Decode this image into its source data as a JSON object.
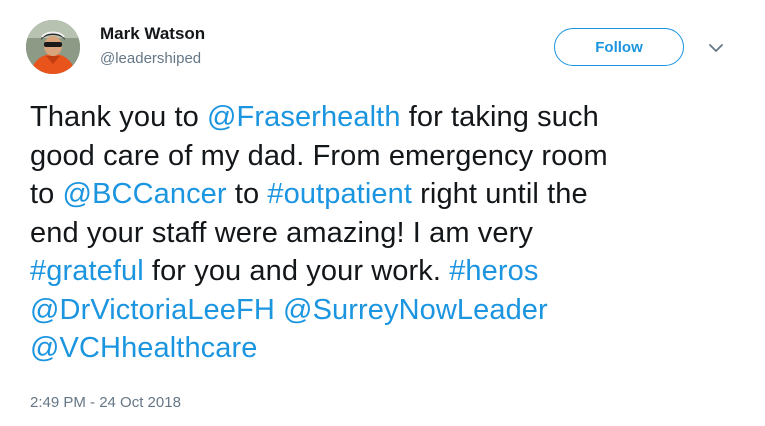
{
  "author": {
    "name": "Mark Watson",
    "handle": "@leadershiped"
  },
  "follow_label": "Follow",
  "tweet": {
    "lines": [
      [
        {
          "t": "Thank you to ",
          "link": false
        },
        {
          "t": "@Fraserhealth",
          "link": true
        },
        {
          "t": " for taking such",
          "link": false
        }
      ],
      [
        {
          "t": "good care of my dad. From emergency room",
          "link": false
        }
      ],
      [
        {
          "t": "to ",
          "link": false
        },
        {
          "t": "@BCCancer",
          "link": true
        },
        {
          "t": " to ",
          "link": false
        },
        {
          "t": "#outpatient",
          "link": true
        },
        {
          "t": " right until the",
          "link": false
        }
      ],
      [
        {
          "t": "end your staff were amazing! I am very",
          "link": false
        }
      ],
      [
        {
          "t": "#grateful",
          "link": true
        },
        {
          "t": " for you and your work. ",
          "link": false
        },
        {
          "t": "#heros",
          "link": true
        }
      ],
      [
        {
          "t": "@DrVictoriaLeeFH",
          "link": true
        },
        {
          "t": " ",
          "link": false
        },
        {
          "t": "@SurreyNowLeader",
          "link": true
        }
      ],
      [
        {
          "t": "@VCHhealthcare",
          "link": true
        }
      ]
    ]
  },
  "timestamp": "2:49 PM - 24 Oct 2018",
  "colors": {
    "link": "#1b95e0",
    "text": "#14171a",
    "muted": "#657786"
  },
  "icons": {
    "more": "chevron-down-icon",
    "avatar": "avatar"
  }
}
